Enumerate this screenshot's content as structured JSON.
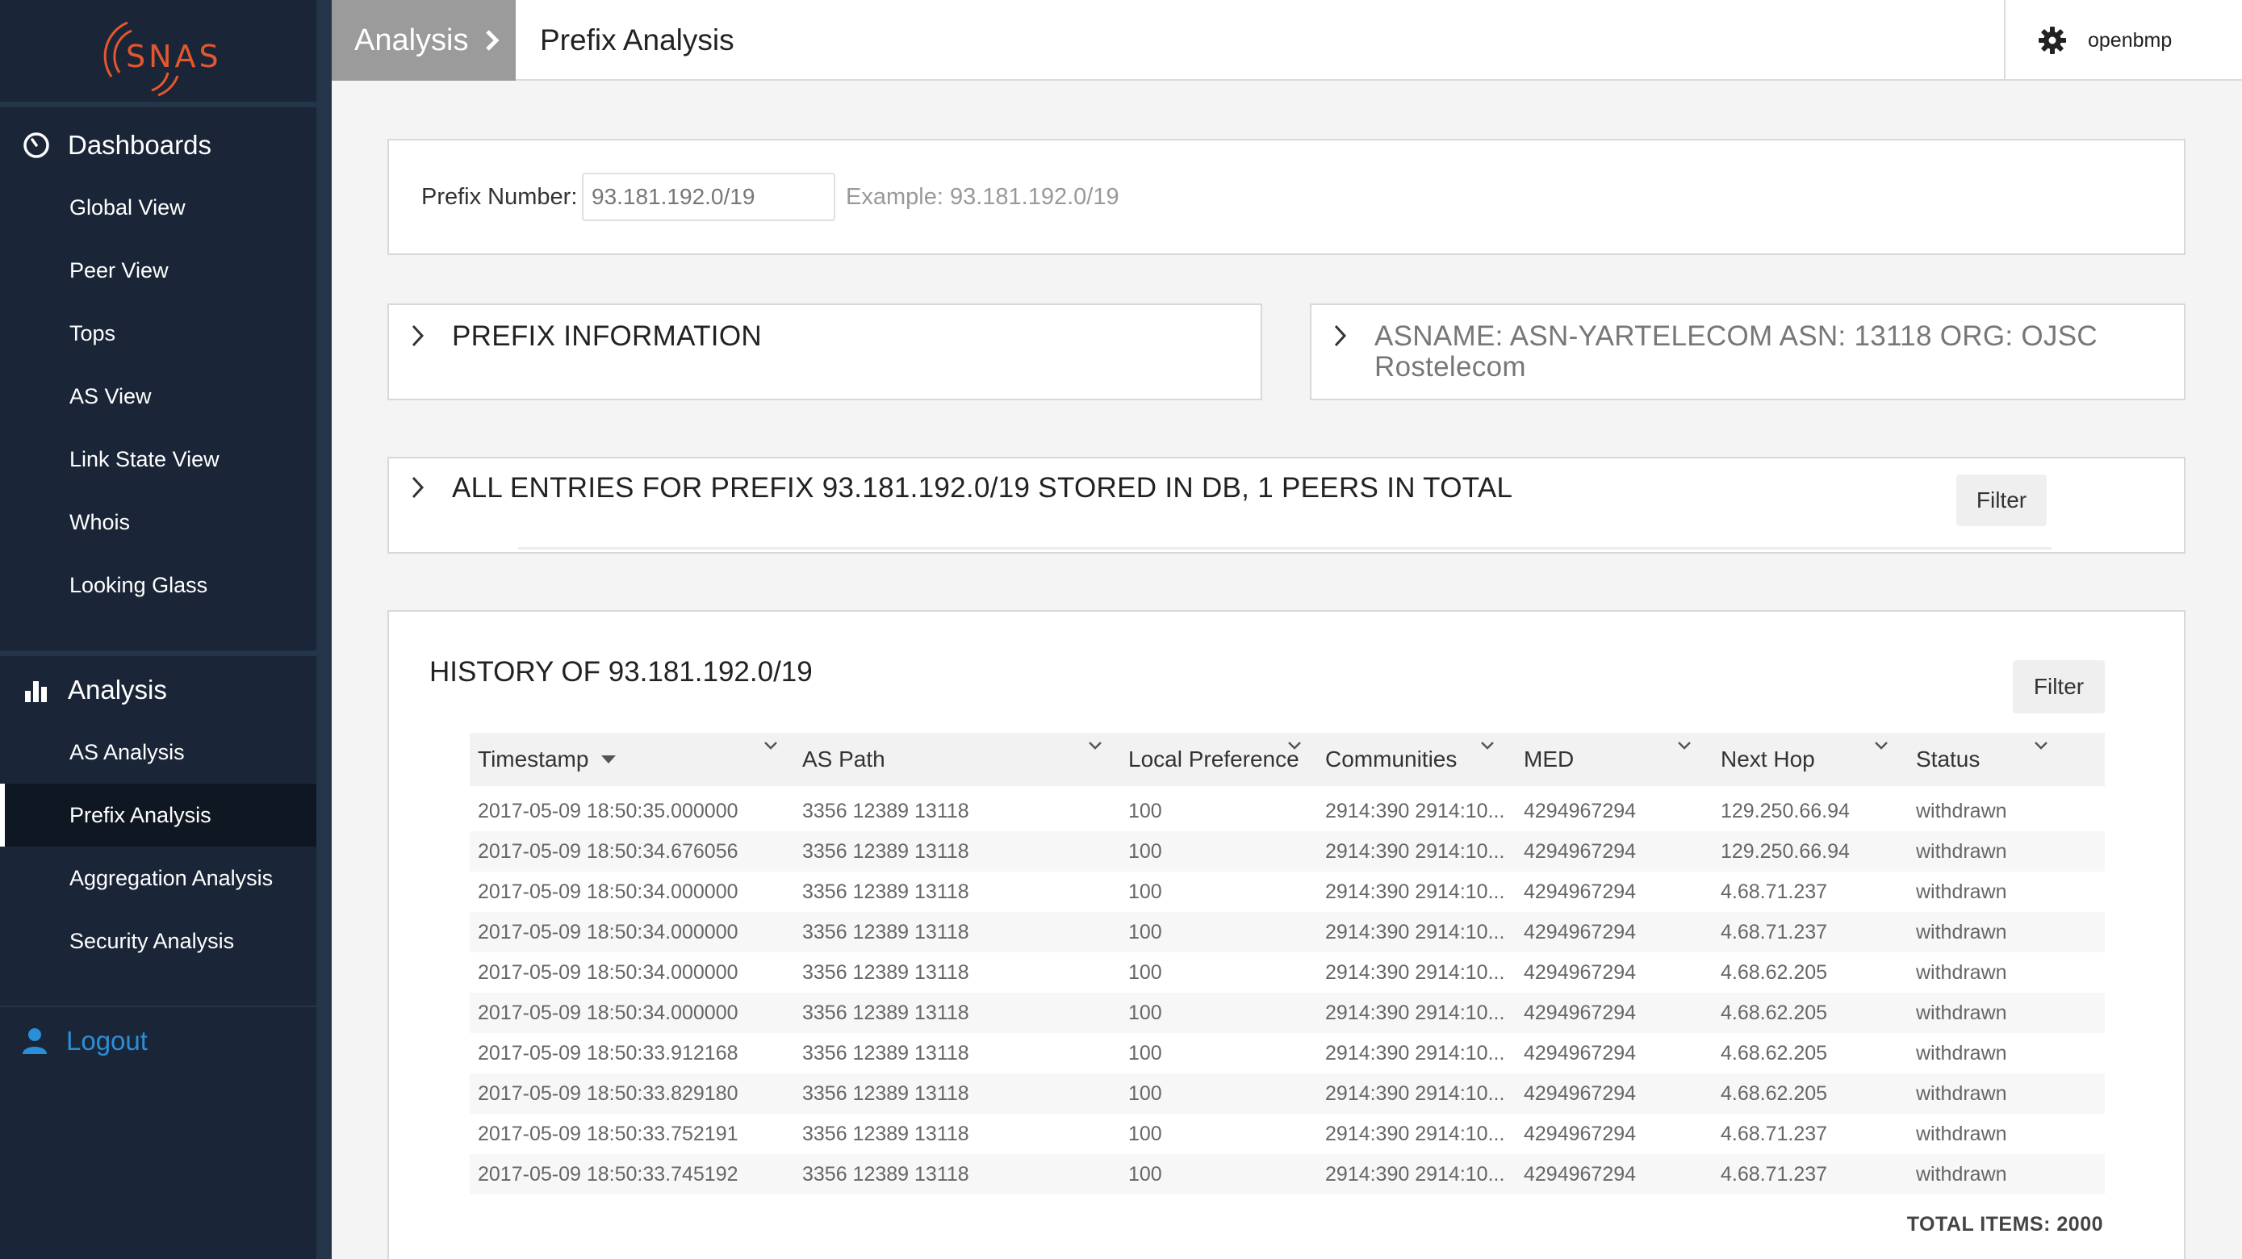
{
  "brand": {
    "logo_text": "SNAS",
    "accent": "#e4572e"
  },
  "sidebar": {
    "dashboards": {
      "label": "Dashboards",
      "icon": "dashboard-icon",
      "items": [
        "Global View",
        "Peer View",
        "Tops",
        "AS View",
        "Link State View",
        "Whois",
        "Looking Glass"
      ]
    },
    "analysis": {
      "label": "Analysis",
      "icon": "bar-chart-icon",
      "items": [
        "AS Analysis",
        "Prefix Analysis",
        "Aggregation Analysis",
        "Security Analysis"
      ],
      "active": "Prefix Analysis"
    },
    "logout": {
      "label": "Logout",
      "icon": "user-icon",
      "color": "#2a8ed8"
    }
  },
  "topbar": {
    "breadcrumb_parent": "Analysis",
    "breadcrumb_current": "Prefix Analysis",
    "username": "openbmp"
  },
  "prefix_search": {
    "label": "Prefix Number:",
    "value": "93.181.192.0/19",
    "example": "Example: 93.181.192.0/19"
  },
  "panels": {
    "prefix_info": "PREFIX INFORMATION",
    "asname_line1": "ASNAME: ASN-YARTELECOM ASN: 13118 ORG: OJSC",
    "asname_line2": "Rostelecom",
    "all_entries": "ALL ENTRIES FOR PREFIX 93.181.192.0/19 STORED IN DB, 1 PEERS IN TOTAL",
    "filter_label": "Filter"
  },
  "history": {
    "title": "HISTORY OF 93.181.192.0/19",
    "filter_label": "Filter",
    "columns": [
      "Timestamp",
      "AS Path",
      "Local Preference",
      "Communities",
      "MED",
      "Next Hop",
      "Status"
    ],
    "rows": [
      [
        "2017-05-09 18:50:35.000000",
        "3356 12389 13118",
        "100",
        "2914:390 2914:10...",
        "4294967294",
        "129.250.66.94",
        "withdrawn"
      ],
      [
        "2017-05-09 18:50:34.676056",
        "3356 12389 13118",
        "100",
        "2914:390 2914:10...",
        "4294967294",
        "129.250.66.94",
        "withdrawn"
      ],
      [
        "2017-05-09 18:50:34.000000",
        "3356 12389 13118",
        "100",
        "2914:390 2914:10...",
        "4294967294",
        "4.68.71.237",
        "withdrawn"
      ],
      [
        "2017-05-09 18:50:34.000000",
        "3356 12389 13118",
        "100",
        "2914:390 2914:10...",
        "4294967294",
        "4.68.71.237",
        "withdrawn"
      ],
      [
        "2017-05-09 18:50:34.000000",
        "3356 12389 13118",
        "100",
        "2914:390 2914:10...",
        "4294967294",
        "4.68.62.205",
        "withdrawn"
      ],
      [
        "2017-05-09 18:50:34.000000",
        "3356 12389 13118",
        "100",
        "2914:390 2914:10...",
        "4294967294",
        "4.68.62.205",
        "withdrawn"
      ],
      [
        "2017-05-09 18:50:33.912168",
        "3356 12389 13118",
        "100",
        "2914:390 2914:10...",
        "4294967294",
        "4.68.62.205",
        "withdrawn"
      ],
      [
        "2017-05-09 18:50:33.829180",
        "3356 12389 13118",
        "100",
        "2914:390 2914:10...",
        "4294967294",
        "4.68.62.205",
        "withdrawn"
      ],
      [
        "2017-05-09 18:50:33.752191",
        "3356 12389 13118",
        "100",
        "2914:390 2914:10...",
        "4294967294",
        "4.68.71.237",
        "withdrawn"
      ],
      [
        "2017-05-09 18:50:33.745192",
        "3356 12389 13118",
        "100",
        "2914:390 2914:10...",
        "4294967294",
        "4.68.71.237",
        "withdrawn"
      ]
    ],
    "total": "TOTAL ITEMS: 2000"
  }
}
